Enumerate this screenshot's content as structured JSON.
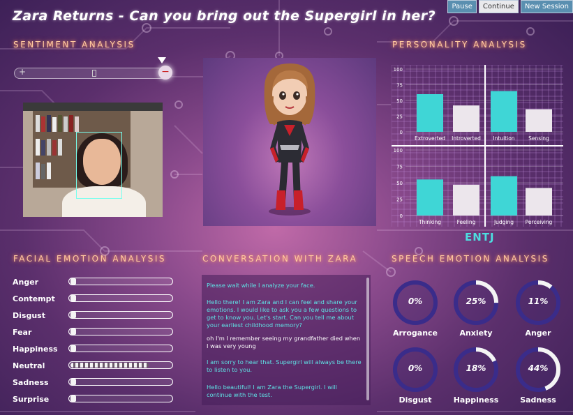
{
  "title": "Zara Returns - Can you bring out the Supergirl in her?",
  "controls": {
    "pause": "Pause",
    "continue": "Continue",
    "new_session": "New Session"
  },
  "sentiment": {
    "title": "SENTIMENT ANALYSIS",
    "plus": "+",
    "minus": "−",
    "level": 0.97
  },
  "personality": {
    "title": "PERSONALITY ANALYSIS",
    "result": "ENTJ",
    "chart_data": [
      {
        "type": "bar",
        "categories": [
          "Extroverted",
          "Introverted",
          "Intuition",
          "Sensing"
        ],
        "values": [
          60,
          42,
          65,
          36
        ],
        "ylim": [
          0,
          100
        ],
        "yticks": [
          "100",
          "75",
          "50",
          "25",
          "0"
        ]
      },
      {
        "type": "bar",
        "categories": [
          "Thinking",
          "Feeling",
          "Judging",
          "Perceiving"
        ],
        "values": [
          55,
          47,
          60,
          42
        ],
        "ylim": [
          0,
          100
        ],
        "yticks": [
          "100",
          "75",
          "50",
          "25",
          "0"
        ]
      }
    ],
    "colors": {
      "high": "#3fd6d6",
      "low": "#ece6ec"
    }
  },
  "facial": {
    "title": "FACIAL EMOTION ANALYSIS",
    "emotions": [
      {
        "label": "Anger",
        "value": 0.05
      },
      {
        "label": "Contempt",
        "value": 0.05
      },
      {
        "label": "Disgust",
        "value": 0.05
      },
      {
        "label": "Fear",
        "value": 0.05
      },
      {
        "label": "Happiness",
        "value": 0.05
      },
      {
        "label": "Neutral",
        "value": 0.78
      },
      {
        "label": "Sadness",
        "value": 0.05
      },
      {
        "label": "Surprise",
        "value": 0.05
      }
    ]
  },
  "conversation": {
    "title": "CONVERSATION WITH ZARA",
    "messages": [
      {
        "from": "zara",
        "text": "Please wait while I analyze your face."
      },
      {
        "from": "zara",
        "text": "Hello there! I am Zara and I can feel and share your emotions. I would like to ask you a few questions to get to know you. Let's start. Can you tell me about your earliest childhood memory?"
      },
      {
        "from": "user",
        "text": "oh I'm I remember seeing my grandfather died when I was very young"
      },
      {
        "from": "zara",
        "text": "I am sorry to hear that. Supergirl will always be there to listen to you."
      },
      {
        "from": "zara",
        "text": "Hello beautiful! I am Zara the Supergirl. I will continue with the test."
      }
    ]
  },
  "speech": {
    "title": "SPEECH EMOTION ANALYSIS",
    "gauges": [
      {
        "label": "Arrogance",
        "value_text": "0%",
        "value": 0
      },
      {
        "label": "Anxiety",
        "value_text": "25%",
        "value": 25
      },
      {
        "label": "Anger",
        "value_text": "11%",
        "value": 11
      },
      {
        "label": "Disgust",
        "value_text": "0%",
        "value": 0
      },
      {
        "label": "Happiness",
        "value_text": "18%",
        "value": 18
      },
      {
        "label": "Sadness",
        "value_text": "44%",
        "value": 44
      }
    ]
  }
}
